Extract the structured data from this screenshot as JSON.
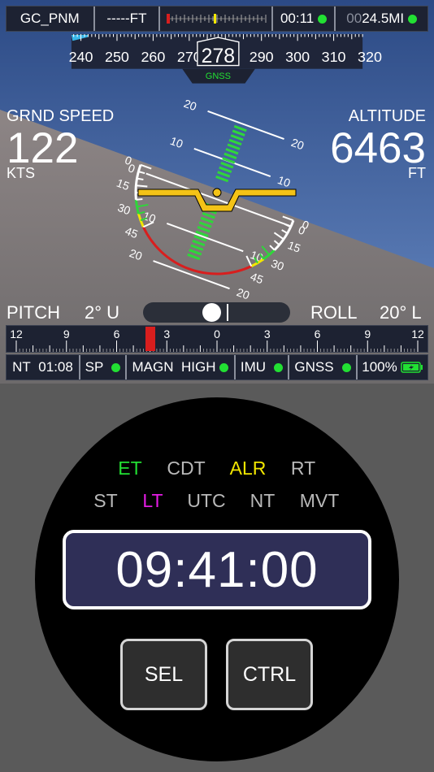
{
  "topbar": {
    "waypoint": "GC_PNM",
    "altitude_readout": "-----FT",
    "flight_time": "00:11",
    "distance_prefix": "00",
    "distance_value": "24.5MI"
  },
  "heading": {
    "current": "278",
    "source_label": "GNSS",
    "ticks": [
      "240",
      "250",
      "260",
      "270",
      "280",
      "290",
      "300",
      "310",
      "320"
    ]
  },
  "ground_speed": {
    "label": "GRND SPEED",
    "value": "122",
    "unit": "KTS"
  },
  "altitude": {
    "label": "ALTITUDE",
    "value": "6463",
    "unit": "FT"
  },
  "attitude": {
    "pitch_ladder_labels": [
      "20",
      "10",
      "0",
      "10",
      "20"
    ],
    "pitch_ladder_labels_right": [
      "20",
      "0",
      "10",
      "20"
    ],
    "left_arc_labels": [
      "0",
      "15",
      "30",
      "45"
    ],
    "right_arc_labels": [
      "0",
      "15",
      "30",
      "45"
    ]
  },
  "pitch": {
    "label": "PITCH",
    "value": "2° U"
  },
  "roll": {
    "label": "ROLL",
    "value": "20° L"
  },
  "roll_scale": {
    "labels": [
      "12",
      "9",
      "6",
      "3",
      "0",
      "3",
      "6",
      "9",
      "12"
    ]
  },
  "status": {
    "nt_label": "NT",
    "nt_time": "01:08",
    "sp_label": "SP",
    "magn_label": "MAGN",
    "magn_value": "HIGH",
    "imu_label": "IMU",
    "gnss_label": "GNSS",
    "battery_percent": "100%"
  },
  "timer": {
    "modes_row1": [
      "ET",
      "CDT",
      "ALR",
      "RT"
    ],
    "modes_row2": [
      "ST",
      "LT",
      "UTC",
      "NT",
      "MVT"
    ],
    "time": "09:41:00",
    "sel_label": "SEL",
    "ctrl_label": "CTRL"
  },
  "colors": {
    "sky": "#3f5f96",
    "ground": "#7b7677",
    "status_green": "#22e033",
    "active_green": "#22e033",
    "alarm_yellow": "#f2e600",
    "lt_magenta": "#e51ce5",
    "inactive_grey": "#b9b9b9",
    "panel_navy": "#1d2232",
    "clock_navy": "#2f2f57",
    "wing_yellow": "#f4c317",
    "red_arc": "#d81e1e"
  }
}
